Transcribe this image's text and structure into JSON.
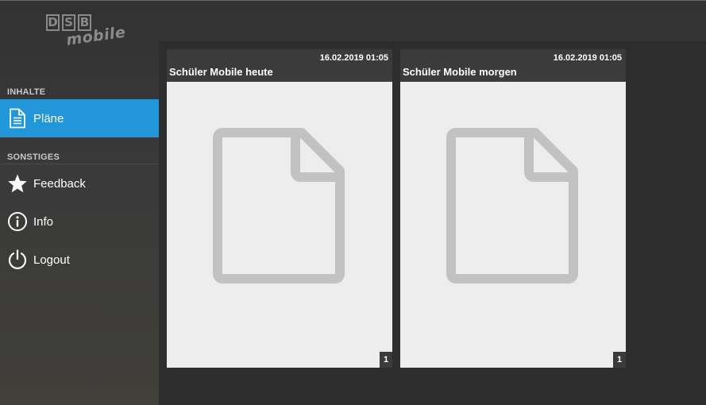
{
  "app": {
    "logo_letters": [
      "D",
      "S",
      "B"
    ],
    "logo_sub": "mobile"
  },
  "sidebar": {
    "sections": [
      {
        "title": "INHALTE",
        "items": [
          {
            "label": "Pläne",
            "icon": "document-icon",
            "active": true
          }
        ]
      },
      {
        "title": "SONSTIGES",
        "items": [
          {
            "label": "Feedback",
            "icon": "star-icon"
          },
          {
            "label": "Info",
            "icon": "info-icon"
          },
          {
            "label": "Logout",
            "icon": "power-icon"
          }
        ]
      }
    ]
  },
  "plans": [
    {
      "date": "16.02.2019 01:05",
      "title": "Schüler Mobile heute",
      "pages": "1"
    },
    {
      "date": "16.02.2019 01:05",
      "title": "Schüler Mobile morgen",
      "pages": "1"
    }
  ],
  "colors": {
    "accent": "#2196d8",
    "sidebar_bg": "#363636",
    "content_bg": "#2d2d2d",
    "card_header": "#3b3b3b",
    "card_body": "#ededed",
    "doc_icon": "#c2c2c2"
  }
}
